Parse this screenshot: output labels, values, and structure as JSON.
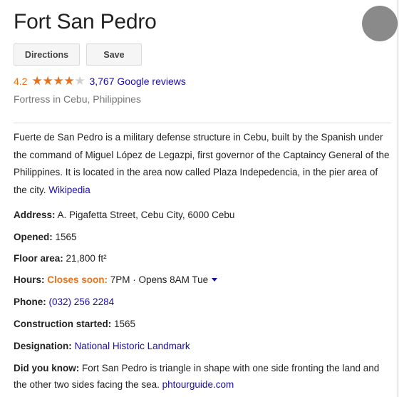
{
  "place": {
    "title": "Fort San Pedro",
    "rating": "4.2",
    "stars_filled": 4,
    "stars_total": 5,
    "reviews": "3,767 Google reviews",
    "type": "Fortress in Cebu, Philippines"
  },
  "actions": {
    "directions": "Directions",
    "save": "Save"
  },
  "description": {
    "text": "Fuerte de San Pedro is a military defense structure in Cebu, built by the Spanish under the command of Miguel López de Legazpi, first governor of the Captaincy General of the Philippines. It is located in the area now called Plaza Indepedencia, in the pier area of the city.",
    "source": "Wikipedia"
  },
  "facts": {
    "address": {
      "label": "Address:",
      "value": "A. Pigafetta Street, Cebu City, 6000 Cebu"
    },
    "opened": {
      "label": "Opened:",
      "value": "1565"
    },
    "floor_area": {
      "label": "Floor area:",
      "value": "21,800 ft²"
    },
    "hours": {
      "label": "Hours:",
      "status": "Closes soon:",
      "value": "7PM · Opens 8AM Tue"
    },
    "phone": {
      "label": "Phone:",
      "value": "(032) 256 2284"
    },
    "construction": {
      "label": "Construction started:",
      "value": "1565"
    },
    "designation": {
      "label": "Designation:",
      "value": "National Historic Landmark"
    },
    "did_you_know": {
      "label": "Did you know:",
      "value": "Fort San Pedro is triangle in shape with one side fronting the land and the other two sides facing the sea.",
      "source": "phtourguide.com"
    }
  },
  "colors": {
    "accent_orange": "#e7711b",
    "link_blue": "#1a0dab",
    "avatar_gray": "#8a8a8a"
  },
  "icons": {
    "star": "star-icon",
    "hours_dropdown": "chevron-down-icon"
  }
}
